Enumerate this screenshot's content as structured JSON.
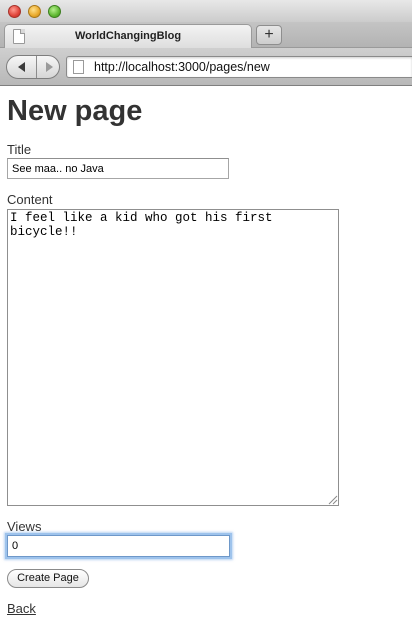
{
  "browser": {
    "tab_title": "WorldChangingBlog",
    "new_tab_label": "+",
    "url": "http://localhost:3000/pages/new"
  },
  "page": {
    "heading": "New page",
    "fields": {
      "title_label": "Title",
      "title_value": "See maa.. no Java",
      "content_label": "Content",
      "content_value": "I feel like a kid who got his first\nbicycle!!",
      "views_label": "Views",
      "views_value": "0"
    },
    "submit_label": "Create Page",
    "back_link": "Back"
  },
  "icons": {
    "window_buttons": [
      "close-icon",
      "minimize-icon",
      "maximize-icon"
    ],
    "nav": [
      "back-arrow-icon",
      "forward-arrow-icon"
    ],
    "page": "page-icon"
  },
  "colors": {
    "focus_ring": "#9ec3ec",
    "text": "#333333"
  }
}
